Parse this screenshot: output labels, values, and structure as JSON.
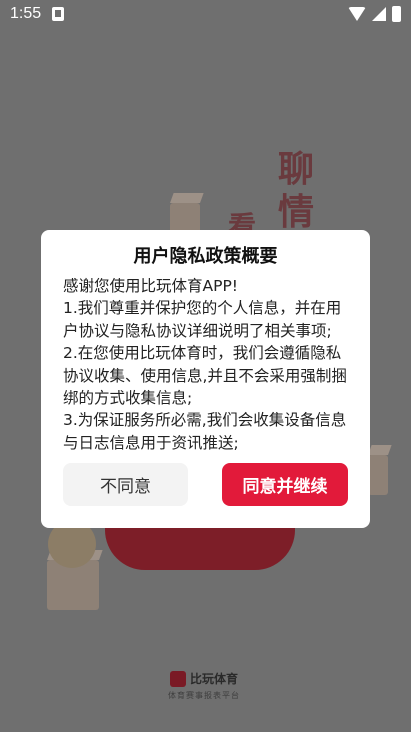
{
  "status_bar": {
    "time": "1:55"
  },
  "background": {
    "chars": [
      "聊",
      "情",
      "看"
    ]
  },
  "footer": {
    "brand": "比玩体育",
    "subtitle": "体育赛事报表平台"
  },
  "dialog": {
    "title": "用户隐私政策概要",
    "paragraphs": [
      "感谢您使用比玩体育APP!",
      "1.我们尊重并保护您的个人信息，并在用户协议与隐私协议详细说明了相关事项;",
      "2.在您使用比玩体育时，我们会遵循隐私协议收集、使用信息,并且不会采用强制捆绑的方式收集信息;",
      "3.为保证服务所必需,我们会收集设备信息与日志信息用于资讯推送;"
    ],
    "disagree_label": "不同意",
    "agree_label": "同意并继续"
  },
  "colors": {
    "accent": "#e21a3a",
    "overlay": "#6f6f6f"
  }
}
